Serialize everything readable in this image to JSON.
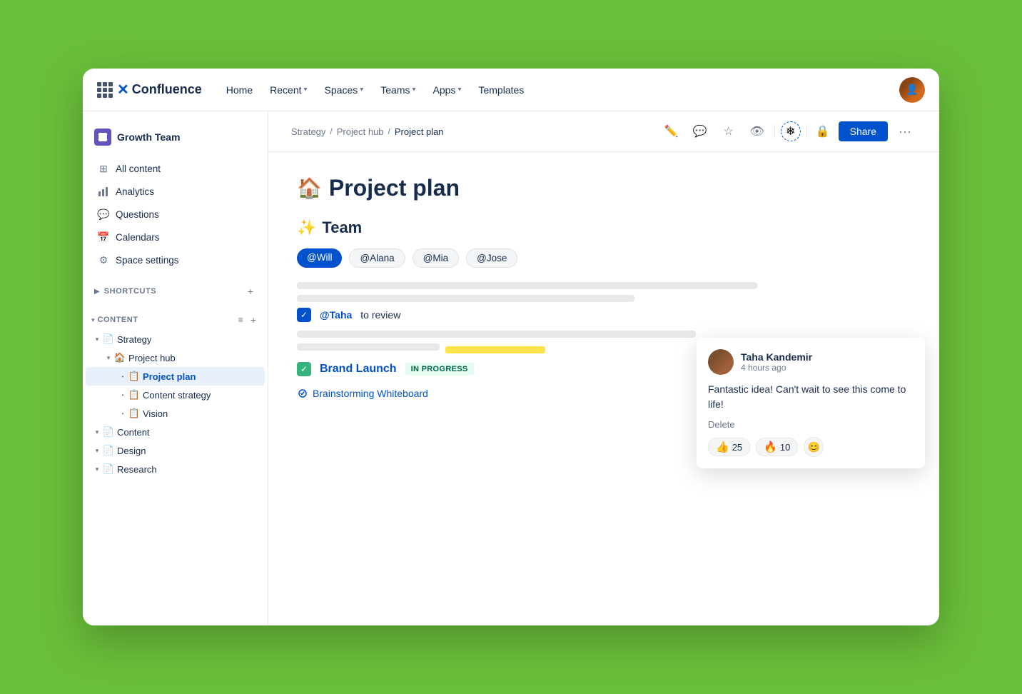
{
  "nav": {
    "home": "Home",
    "recent": "Recent",
    "spaces": "Spaces",
    "teams": "Teams",
    "apps": "Apps",
    "templates": "Templates",
    "logo_text": "Confluence"
  },
  "sidebar": {
    "space_name": "Growth Team",
    "items": [
      {
        "id": "all-content",
        "label": "All content",
        "icon": "⊞"
      },
      {
        "id": "analytics",
        "label": "Analytics",
        "icon": "📊"
      },
      {
        "id": "questions",
        "label": "Questions",
        "icon": "💬"
      },
      {
        "id": "calendars",
        "label": "Calendars",
        "icon": "📅"
      },
      {
        "id": "space-settings",
        "label": "Space settings",
        "icon": "⚙"
      }
    ],
    "shortcuts_label": "SHORTCUTS",
    "content_label": "CONTENT",
    "tree": [
      {
        "id": "strategy",
        "label": "Strategy",
        "icon": "📄",
        "indent": 0,
        "expanded": true,
        "children": [
          {
            "id": "project-hub",
            "label": "Project hub",
            "icon": "🏠",
            "indent": 1,
            "expanded": true,
            "children": [
              {
                "id": "project-plan",
                "label": "Project plan",
                "icon": "📋",
                "indent": 2,
                "active": true
              },
              {
                "id": "content-strategy",
                "label": "Content strategy",
                "icon": "📋",
                "indent": 2
              },
              {
                "id": "vision",
                "label": "Vision",
                "icon": "📋",
                "indent": 2
              }
            ]
          }
        ]
      },
      {
        "id": "content",
        "label": "Content",
        "icon": "📄",
        "indent": 0,
        "expanded": false
      },
      {
        "id": "design",
        "label": "Design",
        "icon": "📄",
        "indent": 0,
        "expanded": false
      },
      {
        "id": "research",
        "label": "Research",
        "icon": "📄",
        "indent": 0,
        "expanded": false
      }
    ]
  },
  "breadcrumb": {
    "items": [
      "Strategy",
      "Project hub",
      "Project plan"
    ]
  },
  "page": {
    "title_emoji": "🏠",
    "title": "Project plan",
    "team_heading_emoji": "✨",
    "team_heading": "Team",
    "team_tags": [
      {
        "label": "@Will",
        "primary": true
      },
      {
        "label": "@Alana",
        "primary": false
      },
      {
        "label": "@Mia",
        "primary": false
      },
      {
        "label": "@Jose",
        "primary": false
      }
    ],
    "task_mention": "@Taha",
    "task_text": " to review",
    "brand_launch_title": "Brand Launch",
    "brand_launch_status": "IN PROGRESS",
    "brainstorm_link": "Brainstorming Whiteboard"
  },
  "comment": {
    "author": "Taha Kandemir",
    "time": "4 hours ago",
    "body": "Fantastic idea! Can't wait to see this come to life!",
    "delete_label": "Delete",
    "reactions": [
      {
        "emoji": "👍",
        "count": "25"
      },
      {
        "emoji": "🔥",
        "count": "10"
      }
    ]
  },
  "actions": {
    "share": "Share"
  }
}
